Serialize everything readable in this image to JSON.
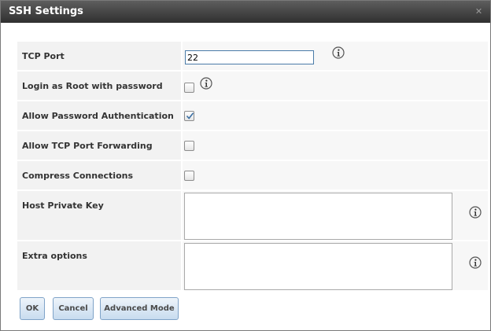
{
  "window": {
    "title": "SSH Settings",
    "close_icon": "close-icon"
  },
  "fields": {
    "tcp_port": {
      "label": "TCP Port",
      "value": "22"
    },
    "login_root": {
      "label": "Login as Root with password",
      "checked": false
    },
    "allow_password_auth": {
      "label": "Allow Password Authentication",
      "checked": true
    },
    "allow_tcp_forwarding": {
      "label": "Allow TCP Port Forwarding",
      "checked": false
    },
    "compress": {
      "label": "Compress Connections",
      "checked": false
    },
    "host_private_key": {
      "label": "Host Private Key",
      "value": ""
    },
    "extra_options": {
      "label": "Extra options",
      "value": ""
    }
  },
  "buttons": {
    "ok": "OK",
    "cancel": "Cancel",
    "advanced": "Advanced Mode"
  },
  "colors": {
    "titlebar": "#3c3c3c",
    "accent": "#4a7ba8",
    "button_bg": "#c8dcef"
  }
}
